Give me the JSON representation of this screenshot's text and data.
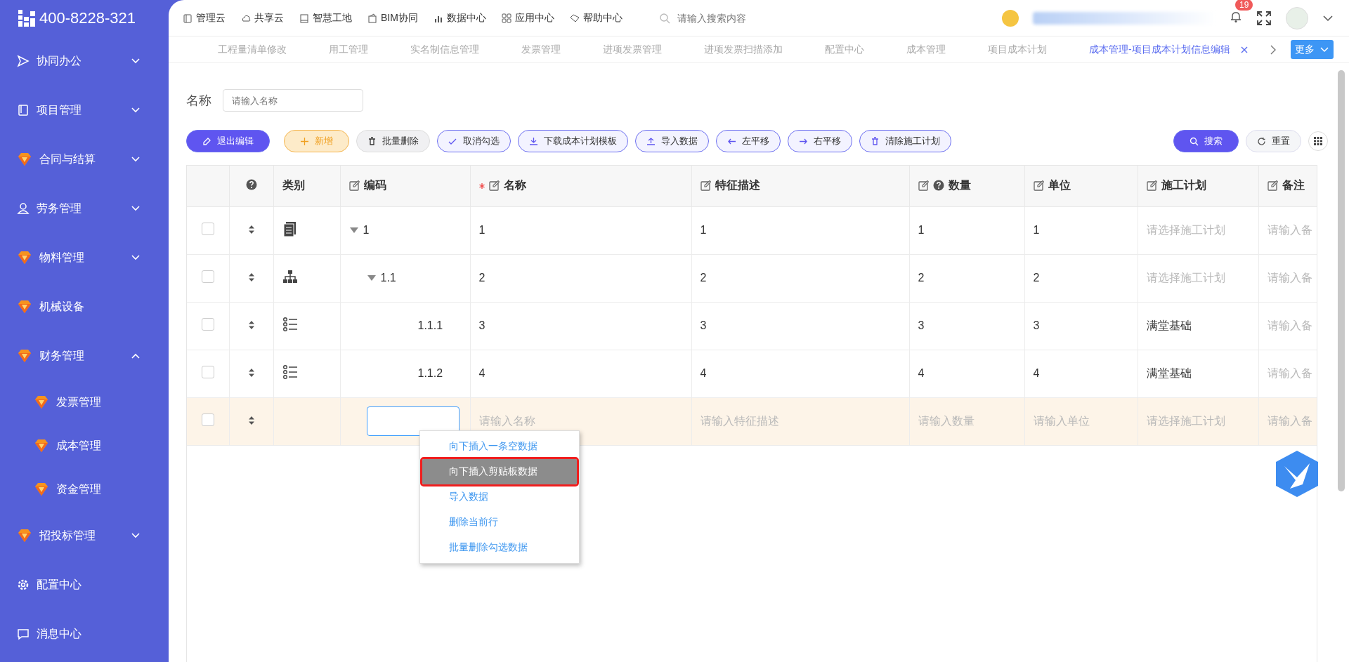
{
  "sidebar": {
    "logo_text": "400-8228-321",
    "items": [
      {
        "label": "协同办公",
        "kind": "group",
        "expanded": false
      },
      {
        "label": "项目管理",
        "kind": "group",
        "expanded": false
      },
      {
        "label": "合同与结算",
        "kind": "group",
        "expanded": false
      },
      {
        "label": "劳务管理",
        "kind": "group",
        "expanded": false
      },
      {
        "label": "物料管理",
        "kind": "group",
        "expanded": false
      },
      {
        "label": "机械设备",
        "kind": "link"
      },
      {
        "label": "财务管理",
        "kind": "group",
        "expanded": true,
        "children": [
          {
            "label": "发票管理"
          },
          {
            "label": "成本管理"
          },
          {
            "label": "资金管理"
          }
        ]
      },
      {
        "label": "招投标管理",
        "kind": "group",
        "expanded": false
      },
      {
        "label": "配置中心",
        "kind": "link"
      },
      {
        "label": "消息中心",
        "kind": "link"
      }
    ]
  },
  "top_nav": {
    "items": [
      "管理云",
      "共享云",
      "智慧工地",
      "BIM协同",
      "数据中心",
      "应用中心",
      "帮助中心"
    ],
    "search_placeholder": "请输入搜索内容",
    "notification_count": "19"
  },
  "tabs": {
    "items": [
      {
        "label": "工程量清单修改",
        "selected": false
      },
      {
        "label": "用工管理",
        "selected": false
      },
      {
        "label": "实名制信息管理",
        "selected": false
      },
      {
        "label": "发票管理",
        "selected": false
      },
      {
        "label": "进项发票管理",
        "selected": false
      },
      {
        "label": "进项发票扫描添加",
        "selected": false
      },
      {
        "label": "配置中心",
        "selected": false
      },
      {
        "label": "成本管理",
        "selected": false
      },
      {
        "label": "项目成本计划",
        "selected": false
      },
      {
        "label": "成本管理-项目成本计划信息编辑",
        "selected": true
      }
    ],
    "more_button": "更多"
  },
  "filter": {
    "label": "名称",
    "placeholder": "请输入名称"
  },
  "toolbar": {
    "buttons": [
      {
        "label": "退出编辑",
        "kind": "primary"
      },
      {
        "label": "新增",
        "kind": "warning"
      },
      {
        "label": "批量删除",
        "kind": "plain"
      },
      {
        "label": "取消勾选",
        "kind": "outline"
      },
      {
        "label": "下载成本计划模板",
        "kind": "outline"
      },
      {
        "label": "导入数据",
        "kind": "outline"
      },
      {
        "label": "左平移",
        "kind": "outline"
      },
      {
        "label": "右平移",
        "kind": "outline"
      },
      {
        "label": "清除施工计划",
        "kind": "outline"
      }
    ],
    "search_button": "搜索",
    "reset_button": "重置"
  },
  "table": {
    "columns": [
      {
        "label": "类别",
        "editable": false,
        "required": false,
        "help": false
      },
      {
        "label": "编码",
        "editable": true,
        "required": false,
        "help": false
      },
      {
        "label": "名称",
        "editable": true,
        "required": true,
        "help": false
      },
      {
        "label": "特征描述",
        "editable": true,
        "required": false,
        "help": false
      },
      {
        "label": "数量",
        "editable": true,
        "required": false,
        "help": true
      },
      {
        "label": "单位",
        "editable": true,
        "required": false,
        "help": false
      },
      {
        "label": "施工计划",
        "editable": true,
        "required": false,
        "help": false
      },
      {
        "label": "备注",
        "editable": true,
        "required": false,
        "help": false
      }
    ],
    "rows": [
      {
        "checked": false,
        "editing": false,
        "expanded": true,
        "cells": [
          {
            "kind": "document"
          },
          {
            "value": "1"
          },
          {
            "value": "1"
          },
          {
            "value": "1"
          },
          {
            "value": "1"
          },
          {
            "value": "1"
          },
          {
            "placeholder": "请选择施工计划"
          },
          {
            "placeholder": "请输入备"
          }
        ],
        "children": [
          {
            "checked": false,
            "editing": false,
            "expanded": true,
            "cells": [
              {
                "kind": "hierarchy"
              },
              {
                "value": "1.1"
              },
              {
                "value": "2"
              },
              {
                "value": "2"
              },
              {
                "value": "2"
              },
              {
                "value": "2"
              },
              {
                "placeholder": "请选择施工计划"
              },
              {
                "placeholder": "请输入备"
              }
            ],
            "children": [
              {
                "checked": false,
                "editing": false,
                "cells": [
                  {
                    "kind": "list"
                  },
                  {
                    "value": "1.1.1"
                  },
                  {
                    "value": "3"
                  },
                  {
                    "value": "3"
                  },
                  {
                    "value": "3"
                  },
                  {
                    "value": "3"
                  },
                  {
                    "value": "满堂基础"
                  },
                  {
                    "placeholder": "请输入备"
                  }
                ]
              },
              {
                "checked": false,
                "editing": false,
                "cells": [
                  {
                    "kind": "list"
                  },
                  {
                    "value": "1.1.2"
                  },
                  {
                    "value": "4"
                  },
                  {
                    "value": "4"
                  },
                  {
                    "value": "4"
                  },
                  {
                    "value": "4"
                  },
                  {
                    "value": "满堂基础"
                  },
                  {
                    "placeholder": "请输入备"
                  }
                ]
              }
            ]
          }
        ]
      },
      {
        "checked": false,
        "editing": true,
        "cells": [
          {
            "kind": "none"
          },
          {
            "kind": "input"
          },
          {
            "placeholder": "请输入名称"
          },
          {
            "placeholder": "请输入特征描述"
          },
          {
            "placeholder": "请输入数量"
          },
          {
            "placeholder": "请输入单位"
          },
          {
            "placeholder": "请选择施工计划"
          },
          {
            "placeholder": "请输入备"
          }
        ]
      }
    ]
  },
  "context_menu": {
    "items": [
      {
        "label": "向下插入一条空数据",
        "selected": false
      },
      {
        "label": "向下插入剪贴板数据",
        "selected": true
      },
      {
        "label": "导入数据",
        "selected": false
      },
      {
        "label": "删除当前行",
        "selected": false
      },
      {
        "label": "批量删除勾选数据",
        "selected": false
      }
    ]
  }
}
